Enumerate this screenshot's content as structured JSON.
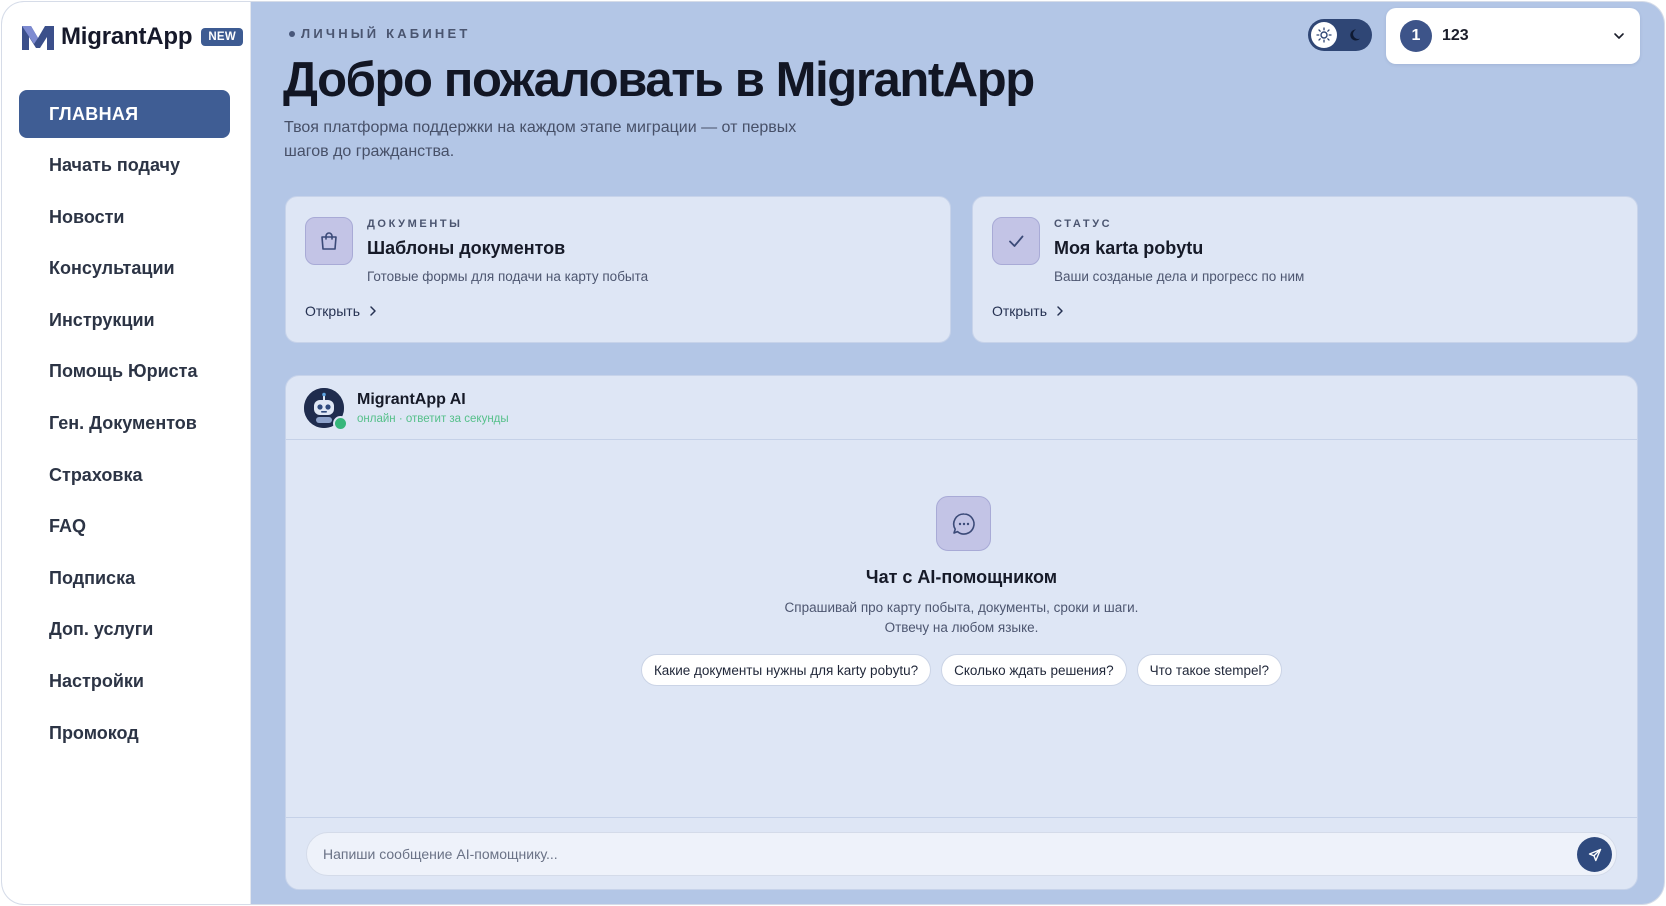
{
  "brand": {
    "name": "MigrantApp",
    "badge": "NEW"
  },
  "sidebar": {
    "items": [
      {
        "label": "ГЛАВНАЯ",
        "active": true
      },
      {
        "label": "Начать подачу"
      },
      {
        "label": "Новости"
      },
      {
        "label": "Консультации"
      },
      {
        "label": "Инструкции"
      },
      {
        "label": "Помощь Юриста"
      },
      {
        "label": "Ген. Документов"
      },
      {
        "label": "Страховка"
      },
      {
        "label": "FAQ"
      },
      {
        "label": "Подписка"
      },
      {
        "label": "Доп. услуги"
      },
      {
        "label": "Настройки"
      },
      {
        "label": "Промокод"
      }
    ]
  },
  "header": {
    "eyebrow": "ЛИЧНЫЙ КАБИНЕТ",
    "title": "Добро пожаловать в MigrantApp",
    "subtitle": "Твоя платформа поддержки на каждом этапе миграции — от первых шагов до гражданства."
  },
  "theme_toggle": {
    "mode": "light",
    "icons": [
      "sun-icon",
      "moon-icon"
    ]
  },
  "user": {
    "number": "1",
    "name": "123"
  },
  "cards": [
    {
      "label": "ДОКУМЕНТЫ",
      "title": "Шаблоны документов",
      "description": "Готовые формы для подачи на карту побыта",
      "action": "Открыть",
      "icon": "shopping-bag-icon"
    },
    {
      "label": "СТАТУС",
      "title": "Моя karta pobytu",
      "description": "Ваши созданые дела и прогресс по ним",
      "action": "Открыть",
      "icon": "check-icon"
    }
  ],
  "chat": {
    "bot_name": "MigrantApp AI",
    "bot_status": "онлайн · ответит за секунды",
    "empty_title": "Чат с AI-помощником",
    "empty_desc_line1": "Спрашивай про карту побыта, документы, сроки и шаги.",
    "empty_desc_line2": "Отвечу на любом языке.",
    "suggestions": [
      "Какие документы нужны для karty pobytu?",
      "Сколько ждать решения?",
      "Что такое stempel?"
    ],
    "input_placeholder": "Напиши сообщение AI-помощнику..."
  },
  "colors": {
    "accent": "#3f5d94",
    "main_bg": "#b3c6e6",
    "card_bg": "#dee6f5",
    "online": "#37b67a"
  }
}
